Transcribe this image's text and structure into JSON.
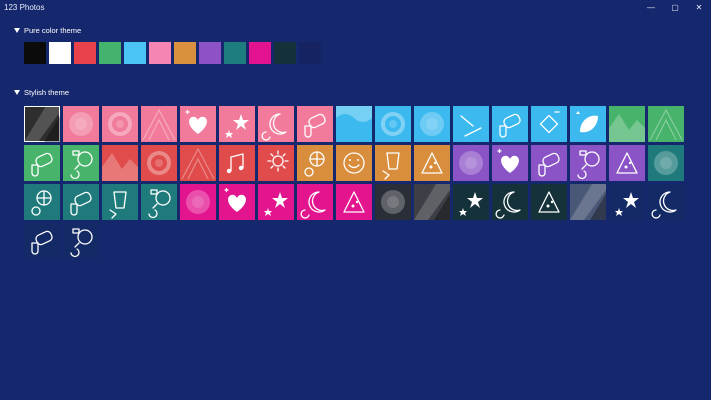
{
  "window": {
    "title": "123 Photos",
    "minimize": "—",
    "maximize": "▢",
    "close": "✕"
  },
  "sections": {
    "pure": "Pure color theme",
    "stylish": "Stylish theme"
  },
  "pure_colors": [
    {
      "name": "black",
      "color": "#0b0b0b"
    },
    {
      "name": "white",
      "color": "#ffffff"
    },
    {
      "name": "red",
      "color": "#e8434b"
    },
    {
      "name": "green",
      "color": "#43b36e"
    },
    {
      "name": "sky",
      "color": "#4cc3f5"
    },
    {
      "name": "pink",
      "color": "#f585b2"
    },
    {
      "name": "orange",
      "color": "#d9913f"
    },
    {
      "name": "purple",
      "color": "#8c52c6"
    },
    {
      "name": "teal",
      "color": "#1e7d7d"
    },
    {
      "name": "magenta",
      "color": "#e1138f"
    },
    {
      "name": "dark-teal",
      "color": "#14303a"
    },
    {
      "name": "navy",
      "color": "#152362"
    }
  ],
  "tiles": [
    {
      "color": "#2e2e2e",
      "pattern": "diagonal",
      "icon": "",
      "selected": true
    },
    {
      "color": "#f27b9c",
      "pattern": "blur"
    },
    {
      "color": "#f27b9c",
      "pattern": "swirl"
    },
    {
      "color": "#f27b9c",
      "pattern": "lines"
    },
    {
      "color": "#f27b9c",
      "icon": "heart"
    },
    {
      "color": "#f27b9c",
      "icon": "stars"
    },
    {
      "color": "#f27b9c",
      "icon": "moon"
    },
    {
      "color": "#f27b9c",
      "icon": "gamepad"
    },
    {
      "color": "#3cbaf0",
      "pattern": "wave"
    },
    {
      "color": "#3cbaf0",
      "pattern": "swirl"
    },
    {
      "color": "#3cbaf0",
      "pattern": "blur"
    },
    {
      "color": "#3cbaf0",
      "icon": "lines"
    },
    {
      "color": "#3cbaf0",
      "icon": "gamepad"
    },
    {
      "color": "#3cbaf0",
      "icon": "shapes"
    },
    {
      "color": "#3cbaf0",
      "icon": "leaf"
    },
    {
      "color": "#47b36b",
      "pattern": "mountain"
    },
    {
      "color": "#47b36b",
      "pattern": "lines"
    },
    {
      "color": "#47b36b",
      "icon": "gamepad"
    },
    {
      "color": "#47b36b",
      "icon": "ball"
    },
    {
      "color": "#e04b4b",
      "pattern": "mountain"
    },
    {
      "color": "#e04b4b",
      "pattern": "swirl"
    },
    {
      "color": "#e04b4b",
      "pattern": "lines"
    },
    {
      "color": "#e04b4b",
      "icon": "music"
    },
    {
      "color": "#e04b4b",
      "icon": "sun"
    },
    {
      "color": "#d98e3e",
      "icon": "globe"
    },
    {
      "color": "#d98e3e",
      "icon": "smile"
    },
    {
      "color": "#d98e3e",
      "icon": "cup"
    },
    {
      "color": "#d98e3e",
      "icon": "pizza"
    },
    {
      "color": "#8b54c6",
      "pattern": "blur"
    },
    {
      "color": "#8b54c6",
      "icon": "heart"
    },
    {
      "color": "#8b54c6",
      "icon": "gamepad"
    },
    {
      "color": "#8b54c6",
      "icon": "ball"
    },
    {
      "color": "#8b54c6",
      "icon": "pizza"
    },
    {
      "color": "#1f7b7b",
      "pattern": "blur"
    },
    {
      "color": "#1f7b7b",
      "icon": "globe"
    },
    {
      "color": "#1f7b7b",
      "icon": "gamepad"
    },
    {
      "color": "#1f7b7b",
      "icon": "cup"
    },
    {
      "color": "#1f7b7b",
      "icon": "ball"
    },
    {
      "color": "#e2158f",
      "pattern": "blur"
    },
    {
      "color": "#e2158f",
      "icon": "heart"
    },
    {
      "color": "#e2158f",
      "icon": "stars"
    },
    {
      "color": "#e2158f",
      "icon": "moon"
    },
    {
      "color": "#e2158f",
      "icon": "pizza"
    },
    {
      "color": "#2a2e36",
      "pattern": "blur"
    },
    {
      "color": "#3c3f46",
      "pattern": "diagonal"
    },
    {
      "color": "#15313a",
      "icon": "stars"
    },
    {
      "color": "#15313a",
      "icon": "moon"
    },
    {
      "color": "#15313a",
      "icon": "pizza"
    },
    {
      "color": "#4a5877",
      "pattern": "diagonal"
    },
    {
      "color": "#142a66",
      "icon": "stars"
    },
    {
      "color": "#142a66",
      "icon": "moon"
    },
    {
      "color": "#142a66",
      "icon": "gamepad"
    },
    {
      "color": "#142a66",
      "icon": "ball"
    }
  ]
}
